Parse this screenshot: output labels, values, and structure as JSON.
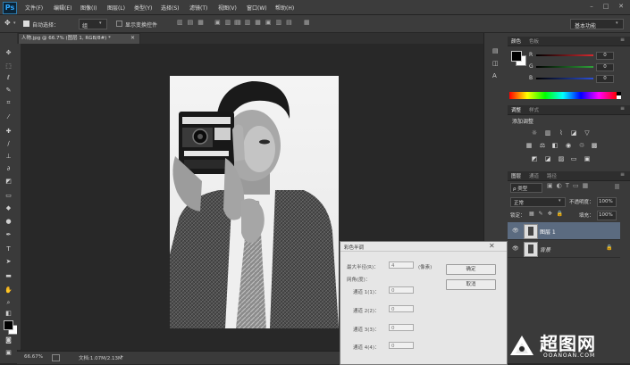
{
  "menubar": {
    "logo": "Ps",
    "items": [
      "文件(F)",
      "编辑(E)",
      "图像(I)",
      "图层(L)",
      "类型(Y)",
      "选择(S)",
      "滤镜(T)",
      "视图(V)",
      "窗口(W)",
      "帮助(H)"
    ],
    "window_buttons": [
      "–",
      "□",
      "✕"
    ]
  },
  "options": {
    "auto_select_label": "自动选择：",
    "auto_select_value": "组",
    "show_transform_label": "显示变换控件",
    "workspace": "基本功能"
  },
  "document": {
    "tab_title": "人物.jpg @ 66.7% (图层 1, RGB/8#) *",
    "zoom": "66.67%",
    "doc_size": "文档:1.07M/2.13M"
  },
  "color_panel": {
    "tabs": [
      "颜色",
      "色板"
    ],
    "channels": [
      {
        "label": "R",
        "value": "0",
        "color": "#d4292f"
      },
      {
        "label": "G",
        "value": "0",
        "color": "#2fa23a"
      },
      {
        "label": "B",
        "value": "0",
        "color": "#2b4fd6"
      }
    ]
  },
  "adjustments_panel": {
    "tabs": [
      "调整",
      "样式"
    ],
    "add_label": "添加调整"
  },
  "layers_panel": {
    "tabs": [
      "图层",
      "通道",
      "路径"
    ],
    "kind_label": "ρ 类型",
    "blend_mode": "正常",
    "opacity_label": "不透明度：",
    "opacity_value": "100%",
    "lock_label": "锁定：",
    "fill_label": "填充：",
    "fill_value": "100%",
    "layers": [
      {
        "name": "图层 1",
        "selected": true,
        "locked": false
      },
      {
        "name": "背景",
        "selected": false,
        "locked": true
      }
    ]
  },
  "dialog": {
    "title": "彩色半调",
    "max_radius_label": "最大半径(R)：",
    "max_radius_value": "4",
    "max_radius_unit": "(像素)",
    "screen_angles_label": "网角(度)：",
    "channels": [
      {
        "label": "通道 1(1)：",
        "value": "0"
      },
      {
        "label": "通道 2(2)：",
        "value": "0"
      },
      {
        "label": "通道 3(3)：",
        "value": "0"
      },
      {
        "label": "通道 4(4)：",
        "value": "0"
      }
    ],
    "ok_label": "确定",
    "cancel_label": "取消"
  },
  "watermark": {
    "text": "超图网",
    "url": "OOANOAN.COM"
  }
}
